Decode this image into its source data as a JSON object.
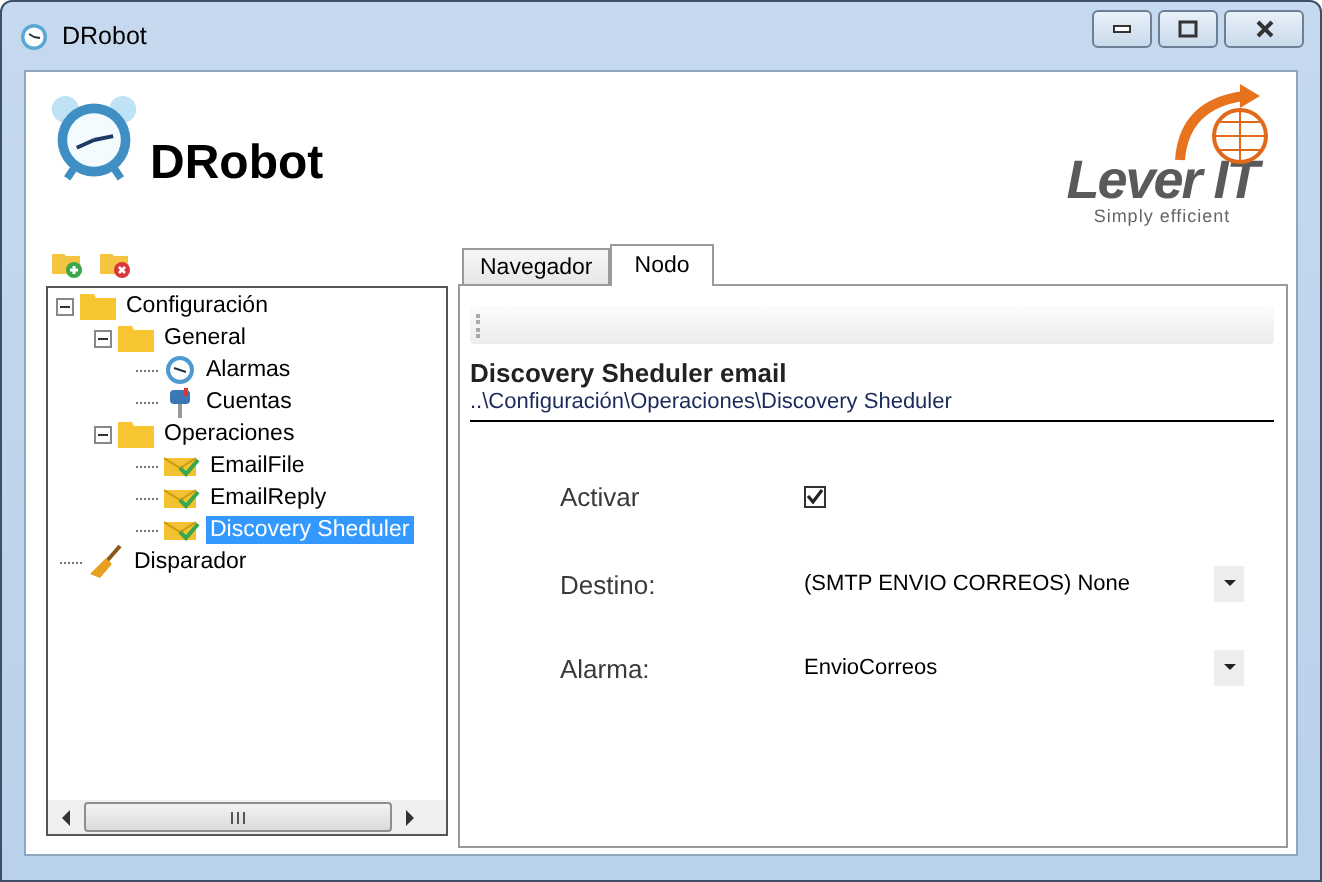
{
  "window": {
    "title": "DRobot"
  },
  "header": {
    "app_name": "DRobot",
    "logo_text": "Lever IT",
    "logo_tagline": "Simply efficient"
  },
  "tree": [
    {
      "label": "Configuración",
      "kind": "folder",
      "expanded": true,
      "selected": false,
      "children": [
        {
          "label": "General",
          "kind": "folder",
          "expanded": true,
          "selected": false,
          "children": [
            {
              "label": "Alarmas",
              "kind": "alarm",
              "selected": false
            },
            {
              "label": "Cuentas",
              "kind": "mailbox",
              "selected": false
            }
          ]
        },
        {
          "label": "Operaciones",
          "kind": "folder",
          "expanded": true,
          "selected": false,
          "children": [
            {
              "label": "EmailFile",
              "kind": "mail",
              "selected": false
            },
            {
              "label": "EmailReply",
              "kind": "mail",
              "selected": false
            },
            {
              "label": "Discovery Sheduler",
              "kind": "mail",
              "selected": true
            }
          ]
        }
      ]
    },
    {
      "label": "Disparador",
      "kind": "broom",
      "selected": false
    }
  ],
  "tabs": [
    {
      "label": "Navegador",
      "selected": false
    },
    {
      "label": "Nodo",
      "selected": true
    }
  ],
  "node": {
    "title": "Discovery Sheduler email",
    "path": "..\\Configuración\\Operaciones\\Discovery Sheduler"
  },
  "fields": [
    {
      "kind": "checkbox",
      "label": "Activar",
      "checked": true
    },
    {
      "kind": "combo",
      "label": "Destino:",
      "value": "(SMTP ENVIO CORREOS) None"
    },
    {
      "kind": "combo",
      "label": "Alarma:",
      "value": "EnvioCorreos"
    }
  ]
}
